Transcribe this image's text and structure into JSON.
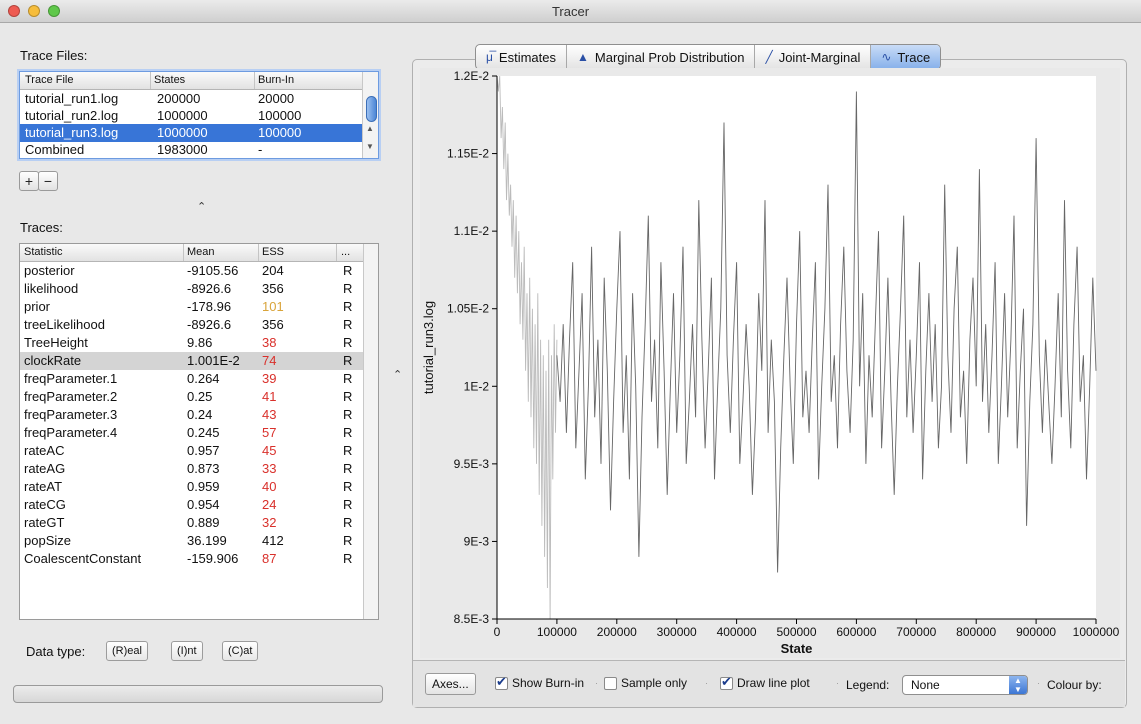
{
  "window": {
    "title": "Tracer"
  },
  "trace_files": {
    "label": "Trace Files:",
    "headers": [
      "Trace File",
      "States",
      "Burn-In"
    ],
    "rows": [
      {
        "file": "tutorial_run1.log",
        "states": "200000",
        "burnin": "20000"
      },
      {
        "file": "tutorial_run2.log",
        "states": "1000000",
        "burnin": "100000"
      },
      {
        "file": "tutorial_run3.log",
        "states": "1000000",
        "burnin": "100000"
      },
      {
        "file": "Combined",
        "states": "1983000",
        "burnin": "-"
      }
    ],
    "selected_index": 2,
    "add_label": "+",
    "remove_label": "−"
  },
  "traces": {
    "label": "Traces:",
    "headers": [
      "Statistic",
      "Mean",
      "ESS",
      "..."
    ],
    "rows": [
      {
        "stat": "posterior",
        "mean": "-9105.56",
        "ess": "204",
        "type": "R",
        "ess_color": "#111111"
      },
      {
        "stat": "likelihood",
        "mean": "-8926.6",
        "ess": "356",
        "type": "R",
        "ess_color": "#111111"
      },
      {
        "stat": "prior",
        "mean": "-178.96",
        "ess": "101",
        "type": "R",
        "ess_color": "#d9a43a"
      },
      {
        "stat": "treeLikelihood",
        "mean": "-8926.6",
        "ess": "356",
        "type": "R",
        "ess_color": "#111111"
      },
      {
        "stat": "TreeHeight",
        "mean": "9.86",
        "ess": "38",
        "type": "R",
        "ess_color": "#d9302b"
      },
      {
        "stat": "clockRate",
        "mean": "1.001E-2",
        "ess": "74",
        "type": "R",
        "ess_color": "#d9302b"
      },
      {
        "stat": "freqParameter.1",
        "mean": "0.264",
        "ess": "39",
        "type": "R",
        "ess_color": "#d9302b"
      },
      {
        "stat": "freqParameter.2",
        "mean": "0.25",
        "ess": "41",
        "type": "R",
        "ess_color": "#d9302b"
      },
      {
        "stat": "freqParameter.3",
        "mean": "0.24",
        "ess": "43",
        "type": "R",
        "ess_color": "#d9302b"
      },
      {
        "stat": "freqParameter.4",
        "mean": "0.245",
        "ess": "57",
        "type": "R",
        "ess_color": "#d9302b"
      },
      {
        "stat": "rateAC",
        "mean": "0.957",
        "ess": "45",
        "type": "R",
        "ess_color": "#d9302b"
      },
      {
        "stat": "rateAG",
        "mean": "0.873",
        "ess": "33",
        "type": "R",
        "ess_color": "#d9302b"
      },
      {
        "stat": "rateAT",
        "mean": "0.959",
        "ess": "40",
        "type": "R",
        "ess_color": "#d9302b"
      },
      {
        "stat": "rateCG",
        "mean": "0.954",
        "ess": "24",
        "type": "R",
        "ess_color": "#d9302b"
      },
      {
        "stat": "rateGT",
        "mean": "0.889",
        "ess": "32",
        "type": "R",
        "ess_color": "#d9302b"
      },
      {
        "stat": "popSize",
        "mean": "36.199",
        "ess": "412",
        "type": "R",
        "ess_color": "#111111"
      },
      {
        "stat": "CoalescentConstant",
        "mean": "-159.906",
        "ess": "87",
        "type": "R",
        "ess_color": "#d9302b"
      }
    ],
    "highlighted_index": 5
  },
  "data_type": {
    "label": "Data type:",
    "buttons": [
      "(R)eal",
      "(I)nt",
      "(C)at"
    ]
  },
  "tabs": [
    {
      "label": "Estimates",
      "icon": "mu-icon",
      "glyph": "μ̅"
    },
    {
      "label": "Marginal Prob Distribution",
      "icon": "distribution-icon",
      "glyph": "▲"
    },
    {
      "label": "Joint-Marginal",
      "icon": "scatter-icon",
      "glyph": "╱"
    },
    {
      "label": "Trace",
      "icon": "trace-icon",
      "glyph": "∿"
    }
  ],
  "active_tab": 3,
  "chart_data": {
    "type": "line",
    "title": "",
    "xlabel": "State",
    "ylabel": "tutorial_run3.log",
    "xlim": [
      0,
      1000000
    ],
    "ylim": [
      0.0085,
      0.012
    ],
    "x_ticks": [
      "0",
      "100000",
      "200000",
      "300000",
      "400000",
      "500000",
      "600000",
      "700000",
      "800000",
      "900000",
      "1000000"
    ],
    "y_ticks": [
      "8.5E-3",
      "9E-3",
      "9.5E-3",
      "1E-2",
      "1.05E-2",
      "1.1E-2",
      "1.15E-2",
      "1.2E-2"
    ],
    "grid": false,
    "series": [
      {
        "role": "burn-in",
        "color": "#bbbbbb",
        "x_range": [
          0,
          100000
        ],
        "samples": 45,
        "values": [
          0.0122,
          0.0119,
          0.0121,
          0.0116,
          0.0118,
          0.0114,
          0.0117,
          0.0112,
          0.0115,
          0.0111,
          0.0113,
          0.0109,
          0.0112,
          0.0107,
          0.0111,
          0.0106,
          0.011,
          0.0104,
          0.0108,
          0.0103,
          0.0109,
          0.0101,
          0.0106,
          0.0099,
          0.0107,
          0.0098,
          0.0105,
          0.0096,
          0.0104,
          0.0095,
          0.0106,
          0.0093,
          0.0103,
          0.0091,
          0.0102,
          0.0089,
          0.0101,
          0.0087,
          0.0103,
          0.0085,
          0.0102,
          0.0094,
          0.0104,
          0.0097,
          0.0103
        ]
      },
      {
        "role": "samples",
        "color": "#666666",
        "x_range": [
          100000,
          1000000
        ],
        "values": [
          0.0102,
          0.0099,
          0.0104,
          0.0097,
          0.0103,
          0.0108,
          0.0096,
          0.0101,
          0.0106,
          0.0094,
          0.01,
          0.0109,
          0.0098,
          0.0103,
          0.0095,
          0.0107,
          0.0101,
          0.0092,
          0.0099,
          0.0105,
          0.011,
          0.0097,
          0.0102,
          0.0094,
          0.0106,
          0.01,
          0.0089,
          0.0098,
          0.0104,
          0.0111,
          0.0099,
          0.0103,
          0.0096,
          0.0108,
          0.0101,
          0.0093,
          0.01,
          0.0106,
          0.0097,
          0.0102,
          0.0109,
          0.0095,
          0.0099,
          0.0104,
          0.0098,
          0.0112,
          0.0103,
          0.0096,
          0.0101,
          0.0107,
          0.0094,
          0.01,
          0.0105,
          0.0117,
          0.0102,
          0.0097,
          0.0103,
          0.0108,
          0.0095,
          0.0099,
          0.0104,
          0.01,
          0.0093,
          0.0098,
          0.0106,
          0.0101,
          0.0112,
          0.0097,
          0.0103,
          0.0099,
          0.0088,
          0.0096,
          0.0102,
          0.0107,
          0.01,
          0.0095,
          0.0104,
          0.011,
          0.0098,
          0.0101,
          0.0097,
          0.0103,
          0.0108,
          0.0094,
          0.01,
          0.0105,
          0.0113,
          0.0099,
          0.0102,
          0.0096,
          0.0104,
          0.0109,
          0.0101,
          0.0097,
          0.0103,
          0.0119,
          0.01,
          0.0106,
          0.0095,
          0.0102,
          0.0098,
          0.0104,
          0.011,
          0.0096,
          0.0101,
          0.0107,
          0.0099,
          0.0093,
          0.01,
          0.0105,
          0.0111,
          0.0098,
          0.0103,
          0.0097,
          0.0102,
          0.0108,
          0.0094,
          0.0101,
          0.0106,
          0.0099,
          0.0104,
          0.0096,
          0.01,
          0.0113,
          0.0102,
          0.0097,
          0.0105,
          0.0109,
          0.0098,
          0.0101,
          0.0095,
          0.0103,
          0.0107,
          0.01,
          0.0114,
          0.0099,
          0.0104,
          0.0097,
          0.0102,
          0.0108,
          0.0095,
          0.01,
          0.0106,
          0.0098,
          0.0103,
          0.0111,
          0.0096,
          0.0101,
          0.0105,
          0.0091,
          0.0099,
          0.0104,
          0.0116,
          0.0102,
          0.0097,
          0.0103,
          0.0099,
          0.0095,
          0.01,
          0.0106,
          0.0098,
          0.0112,
          0.0101,
          0.0096,
          0.0104,
          0.0109,
          0.0099,
          0.0102,
          0.0094,
          0.01,
          0.0107,
          0.0101
        ]
      }
    ]
  },
  "bottom": {
    "axes_button": "Axes...",
    "show_burnin": {
      "label": "Show Burn-in",
      "checked": true
    },
    "sample_only": {
      "label": "Sample only",
      "checked": false
    },
    "draw_line": {
      "label": "Draw line plot",
      "checked": true
    },
    "legend_label": "Legend:",
    "legend_value": "None",
    "colour_by_label": "Colour by:"
  }
}
